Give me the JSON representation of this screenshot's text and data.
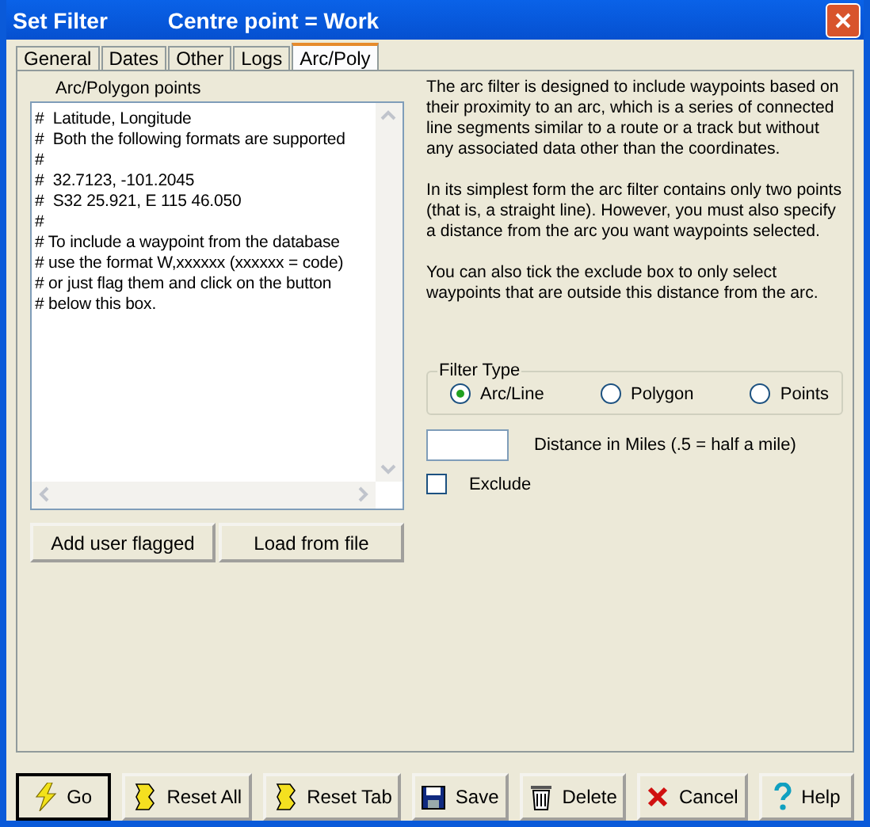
{
  "window": {
    "title": "Set Filter",
    "subtitle": "Centre point = Work"
  },
  "tabs": [
    {
      "label": "General",
      "selected": false
    },
    {
      "label": "Dates",
      "selected": false
    },
    {
      "label": "Other",
      "selected": false
    },
    {
      "label": "Logs",
      "selected": false
    },
    {
      "label": "Arc/Poly",
      "selected": true
    }
  ],
  "points": {
    "label": "Arc/Polygon points",
    "value": "#  Latitude, Longitude\n#  Both the following formats are supported\n#\n#  32.7123, -101.2045\n#  S32 25.921, E 115 46.050\n#\n# To include a waypoint from the database\n# use the format W,xxxxxx (xxxxxx = code)\n# or just flag them and click on the button\n# below this box."
  },
  "points_buttons": [
    "Add user flagged",
    "Load from file"
  ],
  "description": [
    "The arc filter is designed to include waypoints based on their proximity to an arc, which is a series of connected line segments similar to a route or a track but without any associated data other than the coordinates.",
    "In its simplest form the arc filter contains only two points (that is, a straight line). However, you must also specify a distance from the arc you want waypoints selected.",
    "You can also tick the exclude box to only select waypoints that are outside this distance from the arc."
  ],
  "filter_type": {
    "label": "Filter Type",
    "options": [
      {
        "label": "Arc/Line",
        "selected": true
      },
      {
        "label": "Polygon",
        "selected": false
      },
      {
        "label": "Points",
        "selected": false
      }
    ]
  },
  "distance": {
    "label": "Distance in Miles (.5 = half a mile)"
  },
  "exclude": {
    "label": "Exclude",
    "checked": false
  },
  "buttons": [
    {
      "kind": "go",
      "label": "Go"
    },
    {
      "kind": "reset",
      "label": "Reset All"
    },
    {
      "kind": "reset",
      "label": "Reset Tab"
    },
    {
      "kind": "save",
      "label": "Save"
    },
    {
      "kind": "delete",
      "label": "Delete"
    },
    {
      "kind": "cancel",
      "label": "Cancel"
    },
    {
      "kind": "help",
      "label": "Help"
    }
  ]
}
